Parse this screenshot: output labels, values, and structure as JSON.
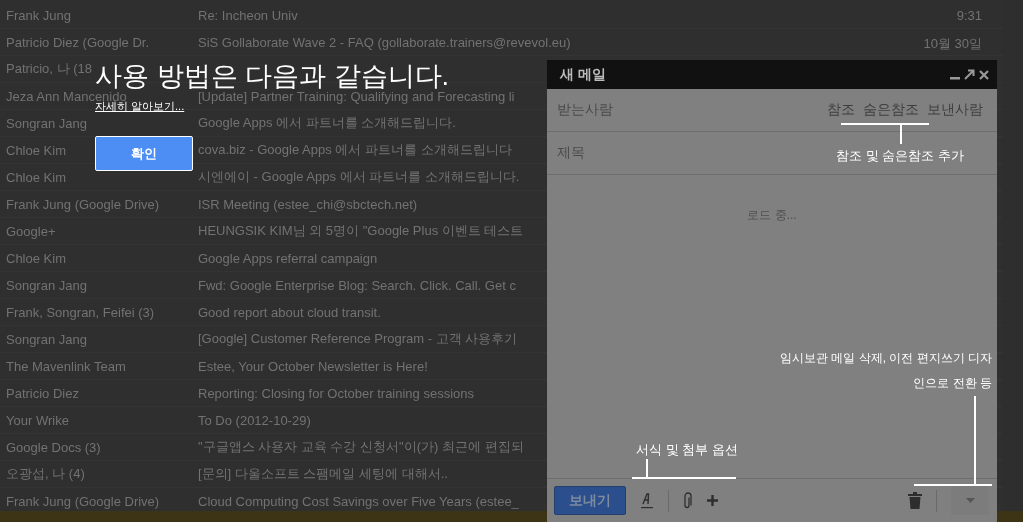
{
  "email_list": [
    {
      "sender": "Frank Jung",
      "subject": "Re: Incheon Univ",
      "date": "9:31"
    },
    {
      "sender": "Patricio Diez (Google Dr.",
      "subject": "SiS Gollaborate Wave 2 - FAQ (gollaborate.trainers@revevol.eu)",
      "date": "10월 30일"
    },
    {
      "sender": "Patricio, 나 (18"
    },
    {
      "sender": "Jeza Ann Mancenido",
      "subject": "[Update] Partner Training: Qualifying and Forecasting li"
    },
    {
      "sender": "Songran Jang",
      "subject": "Google Apps 에서 파트너를 소개해드립니다."
    },
    {
      "sender": "Chloe Kim",
      "subject": "cova.biz - Google Apps 에서 파트너를 소개해드립니다"
    },
    {
      "sender": "Chloe Kim",
      "subject": "시엔에이 - Google Apps 에서 파트너를 소개해드립니다."
    },
    {
      "sender": "Frank Jung (Google Drive)",
      "subject": "ISR Meeting (estee_chi@sbctech.net)"
    },
    {
      "sender": "Google+",
      "subject": "HEUNGSIK KIM님 외 5명이 \"Google Plus 이벤트 테스트"
    },
    {
      "sender": "Chloe Kim",
      "subject": "Google Apps referral campaign"
    },
    {
      "sender": "Songran Jang",
      "subject": "Fwd: Google Enterprise Blog: Search. Click. Call. Get c"
    },
    {
      "sender": "Frank, Songran, Feifei (3)",
      "subject": "Good report about cloud transit."
    },
    {
      "sender": "Songran Jang",
      "subject": "[Google] Customer Reference Program - 고객 사용후기"
    },
    {
      "sender": "The Mavenlink Team",
      "subject": "Estee, Your October Newsletter is Here!"
    },
    {
      "sender": "Patricio Diez",
      "subject": "Reporting: Closing for October training sessions"
    },
    {
      "sender": "Your Wrike",
      "subject": "To Do (2012-10-29)"
    },
    {
      "sender": "Google Docs (3)",
      "subject": "\"구글앱스 사용자 교육 수강 신청서\"이(가) 최근에 편집되"
    },
    {
      "sender": "오광섭, 나 (4)",
      "subject": "[문의] 다울소프트 스팸메일 세팅에 대해서.."
    },
    {
      "sender": "Frank Jung (Google Drive)",
      "subject": "Cloud Computing Cost Savings over Five Years (estee_"
    }
  ],
  "tutorial": {
    "title": "사용 방법은 다음과 같습니다.",
    "link": "자세히 알아보기...",
    "button": "확인"
  },
  "compose": {
    "title": "새 메일",
    "to_label": "받는사람",
    "recipient_links": [
      "참조",
      "숨은참조",
      "보낸사람"
    ],
    "subject_label": "제목",
    "loading_text": "로드 중...",
    "send_button": "보내기"
  },
  "callouts": [
    {
      "kind": "recipients",
      "text": "참조 및 숨은참조 추가"
    },
    {
      "kind": "formatting",
      "text": "서식 및 첨부 옵션"
    },
    {
      "kind": "more",
      "text": "임시보관 메일 삭제, 이전 편지쓰기 디자인으로 전환 등"
    }
  ]
}
